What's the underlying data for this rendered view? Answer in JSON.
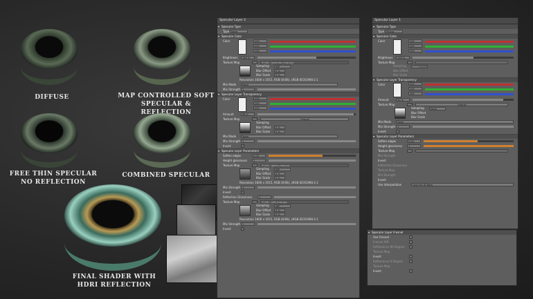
{
  "captions": {
    "diffuse": "DIFFUSE",
    "map_controlled_1": "MAP CONTROLLED SOFT",
    "map_controlled_2": "SPECULAR & REFLECTION",
    "free_thin_1": "FREE THIN SPECULAR",
    "free_thin_2": "NO REFLECTION",
    "combined": "COMBINED SPECULAR",
    "final_1": "FINAL  SHADER WITH",
    "final_2": "HDRI REFLECTION"
  },
  "panel_left": {
    "title": "Specular Layer 2",
    "type_section": "Specular Type",
    "type_label": "Type",
    "type_value": "None",
    "color_section": "Specular Color",
    "color_label": "Color",
    "rgb": [
      "255",
      "255",
      "255"
    ],
    "brightness_label": "Brightness",
    "brightness_value": "100 %",
    "texture_map_label": "Texture Map",
    "texture_path": "E:\\3d\\...\\specular_map.jpg",
    "sampling_label": "Sampling",
    "sampling_value": "MIP",
    "blur_offset_label": "Blur Offset",
    "blur_offset_value": "0 %",
    "blur_scale_label": "Blur Scale",
    "blur_scale_value": "0 %",
    "resolution": "Resolution 1600 x 1015, RGB (8 Bit), sRGB IEC61966-2.1",
    "mix_mode_label": "Mix Mode",
    "mix_mode_value": "None",
    "mix_strength_label": "Mix Strength",
    "mix_strength_value": "1",
    "transp_section": "Specular Layer Transparency",
    "transp_color_label": "Color",
    "transp_rgb": [
      "255",
      "255",
      "255"
    ],
    "amount_label": "Amount",
    "amount_value": "98 %",
    "transp_texture_label": "Texture Map",
    "fresnel": "Fresnel",
    "t_sampling_label": "Sampling",
    "t_blur_offset_label": "Blur Offset",
    "t_blur_offset_value": "0 %",
    "t_blur_scale_label": "Blur Scale",
    "t_blur_scale_value": "0 %",
    "t_mix_mode_label": "Mix Mode",
    "t_mix_mode_value": "None",
    "t_mix_strength_label": "Mix Strength",
    "t_mix_strength_value": "1",
    "invert_label": "Invert",
    "params_section": "Specular Layer Parameters",
    "soften_label": "Soften edges",
    "soften_value": "0.05",
    "height_gloss_label": "Height glossiness",
    "height_gloss_value": "1",
    "p_texture_label": "Texture Map",
    "p_texture_path": "E:\\3d\\...\\gloss_map.jpg",
    "p_sampling_label": "Sampling",
    "p_sampling_value": "MIP",
    "p_blur_offset_label": "Blur Offset",
    "p_blur_offset_value": "0 %",
    "p_blur_scale_label": "Blur Scale",
    "p_blur_scale_value": "0 %",
    "p_resolution": "Resolution 1600 x 1015, RGB (8 Bit), sRGB IEC61966-2.1",
    "p_mix_strength_label": "Mix Strength",
    "p_mix_strength_value": "1",
    "p_invert_label": "Invert",
    "refl_gloss_label": "Reflection Glossiness",
    "refl_gloss_value": "1",
    "r_texture_label": "Texture Map",
    "r_texture_path": "E:\\3d\\...\\refl_map.jpg",
    "r_sampling_label": "Sampling",
    "r_sampling_value": "MIP",
    "r_blur_offset_label": "Blur Offset",
    "r_blur_offset_value": "0 %",
    "r_blur_scale_label": "Blur Scale",
    "r_blur_scale_value": "0 %",
    "r_resolution": "Resolution 1600 x 1015, RGB (8 Bit), sRGB IEC61966-2.1",
    "r_mix_strength_label": "Mix Strength",
    "r_mix_strength_value": "1",
    "r_invert_label": "Invert"
  },
  "panel_right": {
    "title": "Specular Layer 1",
    "type_section": "Specular Type",
    "type_label": "Type",
    "type_value": "Phong",
    "color_section": "Specular Color",
    "color_label": "Color",
    "rgb": [
      "255",
      "255",
      "255"
    ],
    "brightness_label": "Brightness",
    "brightness_value": "100 %",
    "texture_map_label": "Texture Map",
    "sampling_label": "Sampling",
    "sampling_value": "None",
    "blur_offset_label": "Blur Offset",
    "blur_scale_label": "Blur Scale",
    "transp_section": "Specular Layer Transparency",
    "transp_color_label": "Color",
    "transp_rgb": [
      "255",
      "255",
      "255"
    ],
    "amount_label": "Amount",
    "amount_value": "90 %",
    "transp_texture_label": "Texture Map",
    "fresnel": "Fresnel",
    "t_sampling_label": "Sampling",
    "t_sampling_value": "None",
    "t_blur_offset_label": "Blur Offset",
    "t_blur_scale_label": "Blur Scale",
    "t_mix_mode_label": "Mix Mode",
    "t_mix_mode_value": "None",
    "t_mix_strength_label": "Mix Strength",
    "t_mix_strength_value": "1",
    "invert_label": "Invert",
    "params_section": "Specular Layer Parameters",
    "soften_label": "Soften edges",
    "soften_value": "0.05",
    "height_gloss_label": "Height glossiness",
    "height_gloss_value": "1",
    "p_texture_label": "Texture Map",
    "mix_strength_label": "Mix Strength",
    "invert_label2": "Invert",
    "refl_gloss_label": "Reflection Glossiness",
    "r_texture_label": "Texture Map",
    "r_mix_strength_label": "Mix Strength",
    "r_invert_label": "Invert",
    "use_interp_label": "Use Interpolation",
    "use_interp_value": "Only For GI Rays"
  },
  "panel_fresnel": {
    "section": "Specular Layer Fresnel",
    "use_fresnel_label": "Use Fresnel",
    "fresnel_ior_label": "Fresnel IOR",
    "reflectance_label": "Reflectance 90 Degree",
    "texture_map_label": "Texture Map",
    "invert_label": "Invert",
    "reflectance0_label": "Reflectance 0 Degree",
    "texture_map2_label": "Texture Map",
    "invert2_label": "Invert"
  },
  "colors": {
    "panel_bg": "#5e5e5e",
    "section_bg": "#4e4e4e",
    "red_bar": "#c03030",
    "green_bar": "#30b030",
    "blue_bar": "#3050d0",
    "orange_bar": "#d08030"
  }
}
